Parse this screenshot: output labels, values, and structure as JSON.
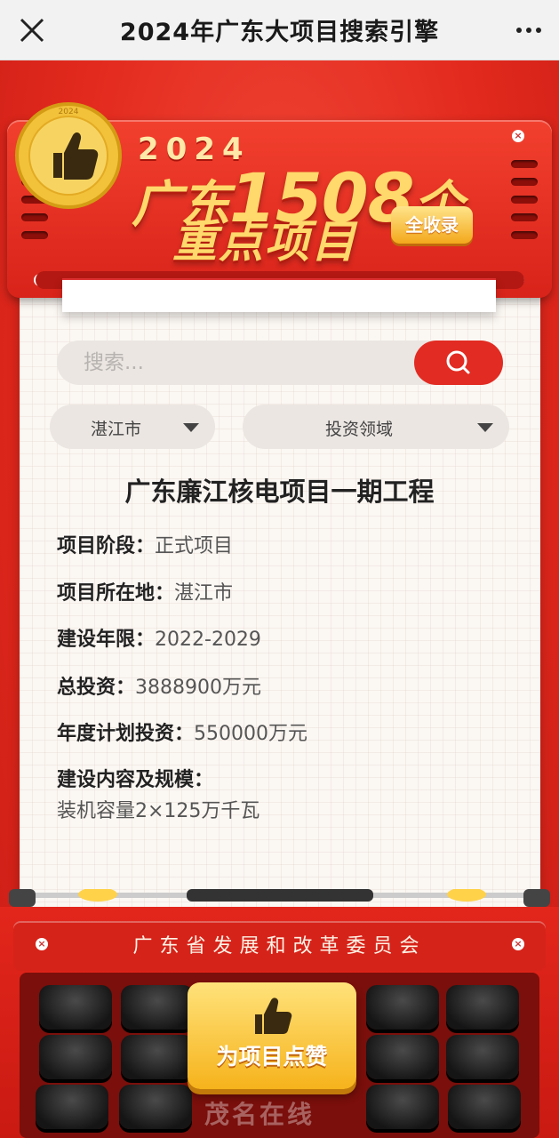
{
  "nav": {
    "title": "2024年广东大项目搜索引擎"
  },
  "banner": {
    "seal_year": "2024",
    "year": "2024",
    "line1_prefix": "广东",
    "line1_number": "1508",
    "line1_suffix": "个",
    "line2": "重点项目",
    "badge": "全收录"
  },
  "search": {
    "placeholder": "搜索..."
  },
  "filters": {
    "city": "湛江市",
    "field": "投资领域"
  },
  "project": {
    "title": "广东廉江核电项目一期工程",
    "stage_label": "项目阶段：",
    "stage_value": "正式项目",
    "location_label": "项目所在地：",
    "location_value": "湛江市",
    "period_label": "建设年限：",
    "period_value": "2022-2029",
    "total_label": "总投资：",
    "total_value": "3888900万元",
    "annual_label": "年度计划投资：",
    "annual_value": "550000万元",
    "scale_label": "建设内容及规模：",
    "scale_value": "装机容量2×125万千瓦"
  },
  "footer": {
    "org": "广东省发展和改革委员会",
    "like_button": "为项目点赞",
    "watermark": "茂名在线"
  },
  "colors": {
    "primary_red": "#e22b22",
    "gold": "#ffd96b"
  }
}
